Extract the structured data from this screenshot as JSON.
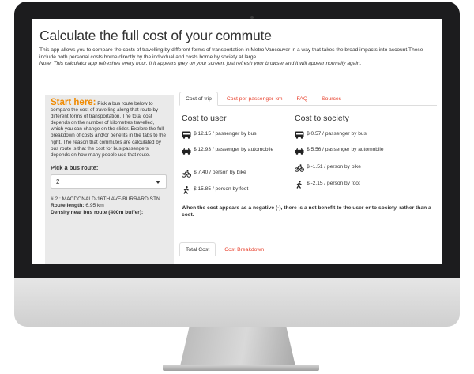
{
  "page": {
    "title": "Calculate the full cost of your commute",
    "intro_1": "This app allows you to compare the costs of travelling by different forms of transportation in Metro Vancouver in a way that takes the broad impacts into account.These include both personal costs borne directly by the individual and costs borne by society at large.",
    "intro_note": "Note: This calculator app refreshes every hour. If it appears grey on your screen, just refresh your browser and it will appear normally again."
  },
  "sidebar": {
    "start_heading": "Start here:",
    "start_text": "Pick a bus route below to compare the cost of travelling along that route by different forms of transportation. The total cost depends on the number of kilometres travelled, which you can change on the slider. Explore the full breakdown of costs and/or benefits in the tabs to the right. The reason that commutes are calculated by bus route is that the cost for bus passengers depends on how many people use that route.",
    "pick_label": "Pick a bus route:",
    "route_select_value": "2",
    "route_name": "# 2 : MACDONALD-16TH AVE/BURRARD STN",
    "route_length_label": "Route length:",
    "route_length_value": "6.95 km",
    "density_label": "Density near bus route (400m buffer):"
  },
  "tabs_top": [
    {
      "label": "Cost of trip",
      "active": true
    },
    {
      "label": "Cost per passenger-km",
      "active": false
    },
    {
      "label": "FAQ",
      "active": false
    },
    {
      "label": "Sources",
      "active": false
    }
  ],
  "cost_user": {
    "heading": "Cost to user",
    "bus": "$ 12.15 / passenger by bus",
    "car": "$ 12.93 / passenger by automobile",
    "bike": "$ 7.40 / person by bike",
    "foot": "$ 15.85 / person by foot"
  },
  "cost_society": {
    "heading": "Cost to society",
    "bus": "$ 0.57 / passenger by bus",
    "car": "$ 5.56 / passenger by automobile",
    "bike": "$ -1.51 / person by bike",
    "foot": "$ -2.15 / person by foot"
  },
  "negative_note": "When the cost appears as a negative (-), there is a net benefit to the user or to society, rather than a cost.",
  "tabs_bottom": [
    {
      "label": "Total Cost",
      "active": true
    },
    {
      "label": "Cost Breakdown",
      "active": false
    }
  ],
  "icons": {
    "bus": "bus-icon",
    "car": "car-icon",
    "bike": "bicycle-icon",
    "foot": "walking-person-icon"
  },
  "colors": {
    "accent_orange": "#f08a00",
    "link_red": "#e8422e",
    "panel_grey": "#eaeaea"
  }
}
